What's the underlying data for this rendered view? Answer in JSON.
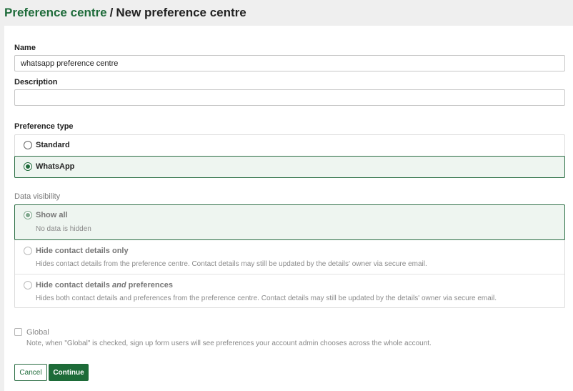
{
  "breadcrumb": {
    "parent": "Preference centre",
    "separator": "/",
    "current": "New preference centre"
  },
  "form": {
    "name_label": "Name",
    "name_value": "whatsapp preference centre",
    "description_label": "Description",
    "description_value": "",
    "preference_type_label": "Preference type",
    "preference_types": [
      {
        "label": "Standard",
        "selected": false
      },
      {
        "label": "WhatsApp",
        "selected": true
      }
    ],
    "data_visibility_label": "Data visibility",
    "visibility_options": [
      {
        "label": "Show all",
        "desc": "No data is hidden",
        "selected": true
      },
      {
        "label": "Hide contact details only",
        "desc": "Hides contact details from the preference centre. Contact details may still be updated by the details' owner via secure email.",
        "selected": false
      },
      {
        "label_prefix": "Hide contact details ",
        "label_em": "and",
        "label_suffix": " preferences",
        "desc": "Hides both contact details and preferences from the preference centre. Contact details may still be updated by the details' owner via secure email.",
        "selected": false
      }
    ],
    "global_label": "Global",
    "global_checked": false,
    "global_note": "Note, when \"Global\" is checked, sign up form users will see preferences your account admin chooses across the whole account."
  },
  "actions": {
    "cancel_label": "Cancel",
    "continue_label": "Continue"
  },
  "colors": {
    "brand_green": "#1e6b3a",
    "selected_bg": "#eef5f0",
    "page_bg": "#efefef"
  }
}
